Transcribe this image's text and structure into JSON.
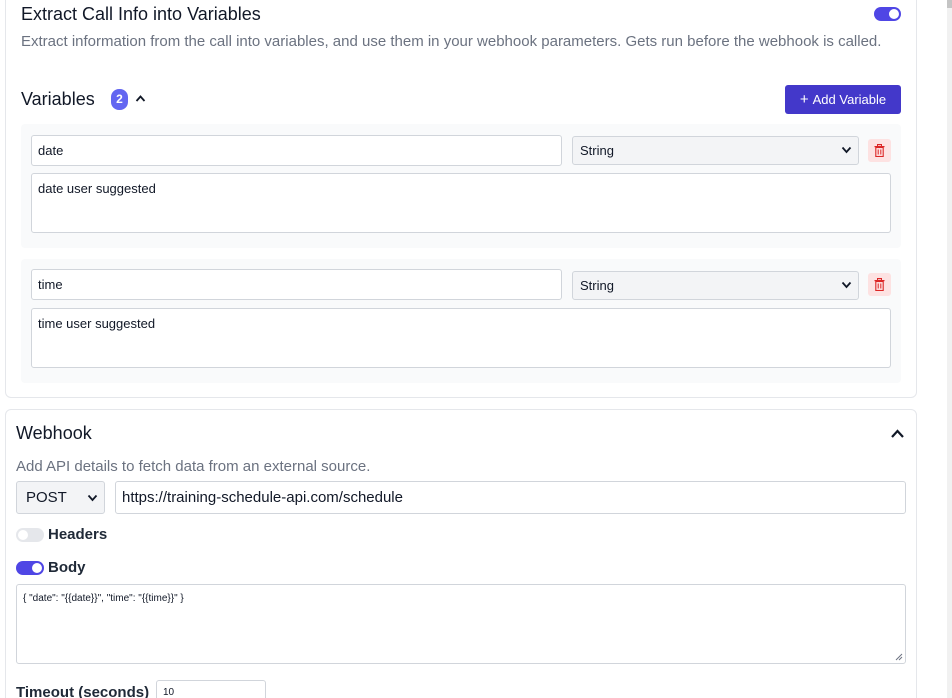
{
  "extract": {
    "title": "Extract Call Info into Variables",
    "enabled": true,
    "description": "Extract information from the call into variables, and use them in your webhook parameters. Gets run before the webhook is called.",
    "variables_title": "Variables",
    "variables_count": "2",
    "add_button": "Add Variable",
    "variables": [
      {
        "name": "date",
        "type": "String",
        "description": "date user suggested"
      },
      {
        "name": "time",
        "type": "String",
        "description": "time user suggested"
      }
    ]
  },
  "webhook": {
    "title": "Webhook",
    "description": "Add API details to fetch data from an external source.",
    "method": "POST",
    "url": "https://training-schedule-api.com/schedule",
    "headers_label": "Headers",
    "headers_enabled": false,
    "body_label": "Body",
    "body_enabled": true,
    "body": "{ \"date\": \"{{date}}\", \"time\": \"{{time}}\" }",
    "timeout_label": "Timeout (seconds)",
    "timeout": "10"
  },
  "colors": {
    "accent": "#4f46e5",
    "button": "#4338ca",
    "badge": "#6366f1",
    "delete_bg": "#fde2e2",
    "delete_icon": "#dc2626"
  },
  "icons": [
    "chevron-up-icon",
    "plus-icon",
    "trash-icon",
    "chevron-down-icon",
    "resize-grip-icon"
  ]
}
